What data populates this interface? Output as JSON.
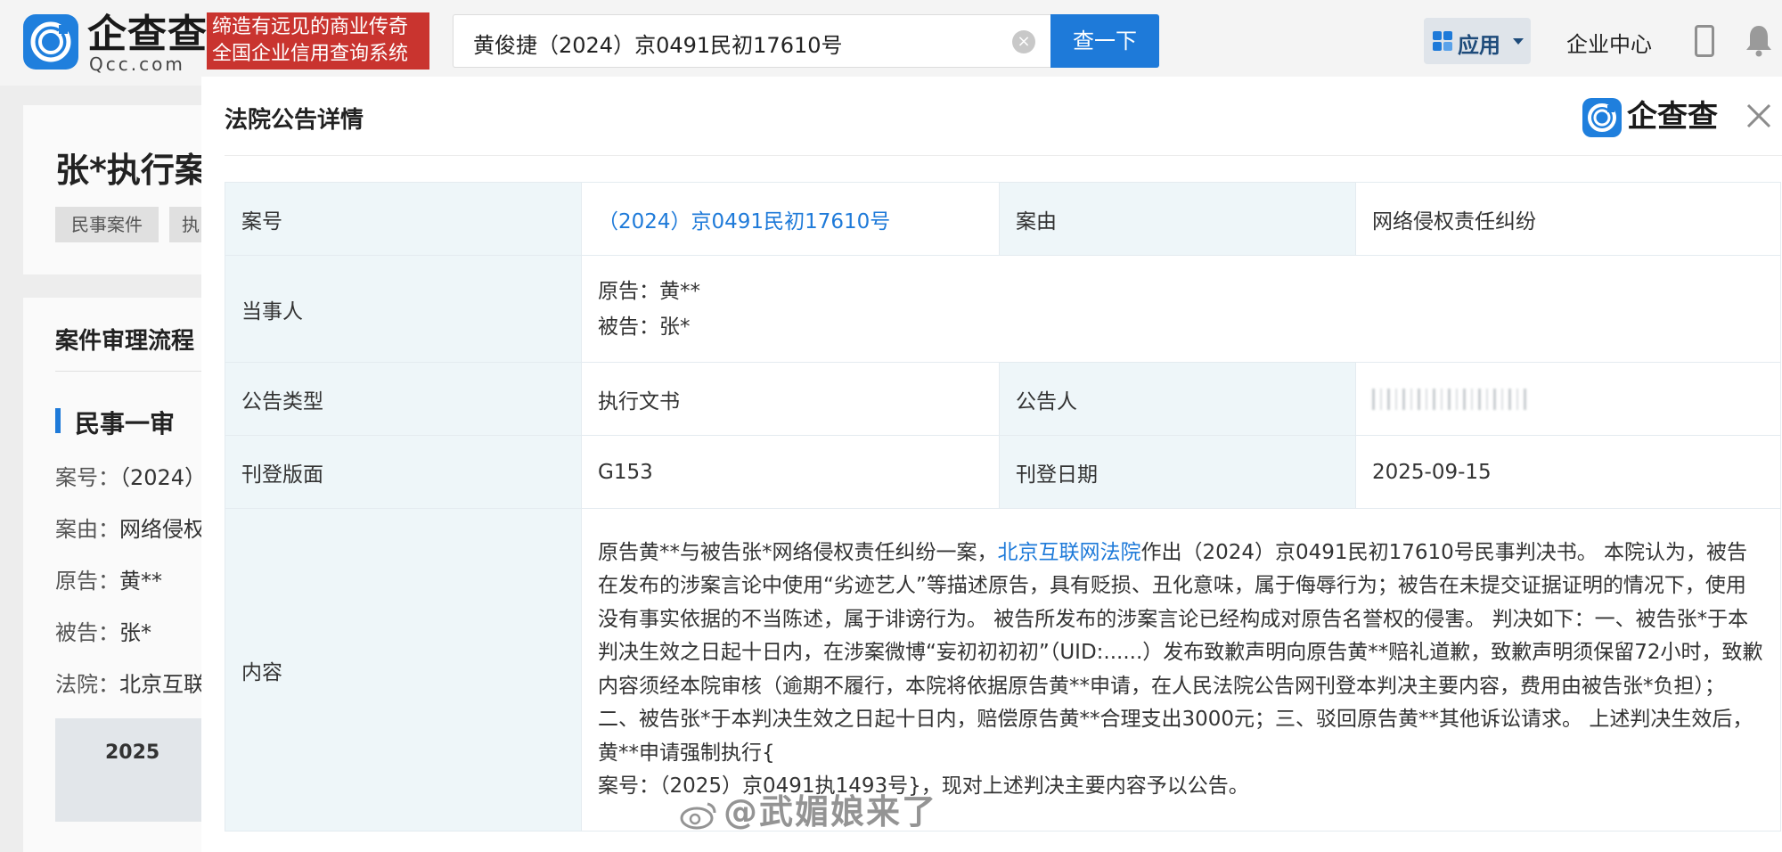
{
  "header": {
    "logo_text": "企查查",
    "logo_domain": "Qcc.com",
    "slogan_line1": "缔造有远见的商业传奇",
    "slogan_line2": "全国企业信用查询系统",
    "search_value": "黄俊捷（2024）京0491民初17610号",
    "search_button": "查一下",
    "apps_label": "应用",
    "enterprise_center": "企业中心",
    "icons": [
      "qcc-logo-icon",
      "clear-icon",
      "grid-icon",
      "chevron-down-icon",
      "phone-icon",
      "bell-icon"
    ],
    "brand_color": "#1e7ad9",
    "slogan_color": "#c9342f"
  },
  "background_page": {
    "title": "张*执行案",
    "tag1": "民事案件",
    "tag2": "执",
    "flow_title": "案件审理流程",
    "stage": "民事一审",
    "rows": [
      {
        "label": "案号：",
        "value": "（2024）"
      },
      {
        "label": "案由：",
        "value": "网络侵权"
      },
      {
        "label": "原告：",
        "value": "黄**"
      },
      {
        "label": "被告：",
        "value": "张*"
      },
      {
        "label": "法院：",
        "value": "北京互联"
      }
    ],
    "box_text": "2025"
  },
  "modal": {
    "title": "法院公告详情",
    "logo_text": "企查查",
    "fields": {
      "case_no_label": "案号",
      "case_no": "（2024）京0491民初17610号",
      "cause_label": "案由",
      "cause": "网络侵权责任纠纷",
      "parties_label": "当事人",
      "plaintiff": "原告：黄**",
      "defendant": "被告：张*",
      "type_label": "公告类型",
      "type": "执行文书",
      "announcer_label": "公告人",
      "page_label": "刊登版面",
      "page": "G153",
      "date_label": "刊登日期",
      "date": "2025-09-15",
      "content_label": "内容"
    },
    "content": {
      "part1": "原告黄**与被告张*网络侵权责任纠纷一案，",
      "court": "北京互联网法院",
      "part2": "作出（2024）京0491民初17610号民事判决书。 本院认为，被告在发布的涉案言论中使用“劣迹艺人”等描述原告，具有贬损、丑化意味，属于侮辱行为；被告在未提交证据证明的情况下，使用没有事实依据的不当陈述，属于诽谤行为。 被告所发布的涉案言论已经构成对原告名誉权的侵害。 判决如下：一、被告张*于本判决生效之日起十日内，在涉案微博“妄初初初初”（UID:......）发布致歉声明向原告黄**赔礼道歉，致歉声明须保留72小时，致歉内容须经本院审核（逾期不履行，本院将依据原告黄**申请，在人民法院公告网刊登本判决主要内容，费用由被告张*负担）；二、被告张*于本判决生效之日起十日内，赔偿原告黄**合理支出3000元；三、驳回原告黄**其他诉讼请求。 上述判决生效后，黄**申请强制执行{",
      "part3": "案号：（2025）京0491执1493号}，现对上述判决主要内容予以公告。"
    },
    "watermark": "@武媚娘来了"
  }
}
